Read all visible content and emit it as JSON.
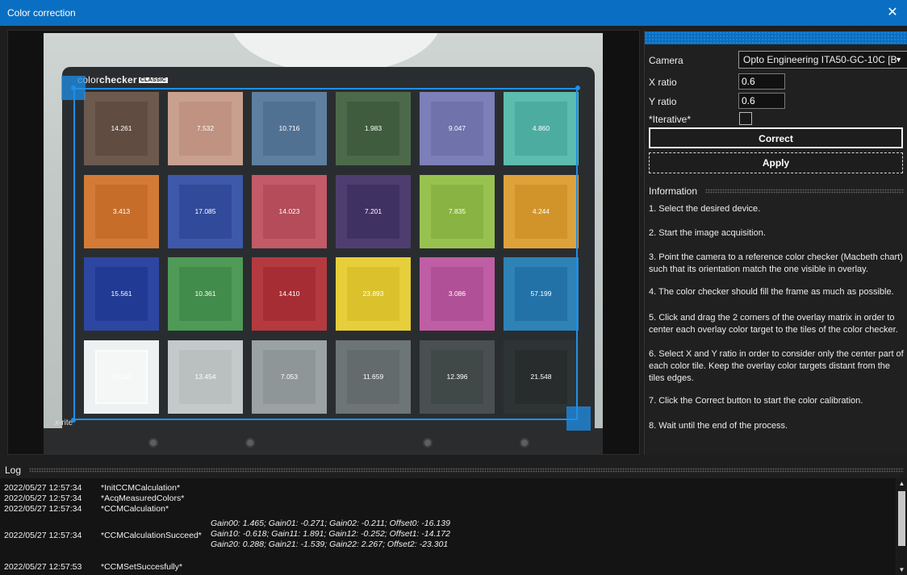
{
  "window": {
    "title": "Color correction",
    "close_symbol": "✕"
  },
  "chart_board": {
    "brand_light": "color",
    "brand_bold": "checker",
    "brand_tag": "CLASSIC",
    "footer_text": "x-rite",
    "tiles": [
      {
        "value": "14.261",
        "color": "#6d5a4e",
        "inner": "#5e4a40"
      },
      {
        "value": "7.532",
        "color": "#c9a08f",
        "inner": "#bd8f80"
      },
      {
        "value": "10.716",
        "color": "#5e7fa0",
        "inner": "#4f6e90"
      },
      {
        "value": "1.983",
        "color": "#4c6a4a",
        "inner": "#3d5a3c"
      },
      {
        "value": "9.047",
        "color": "#7d80b8",
        "inner": "#6c70a8"
      },
      {
        "value": "4.860",
        "color": "#5cbcae",
        "inner": "#4aa99d"
      },
      {
        "value": "3.413",
        "color": "#d37b36",
        "inner": "#c36b28"
      },
      {
        "value": "17.085",
        "color": "#3e59aa",
        "inner": "#2f4896"
      },
      {
        "value": "14.023",
        "color": "#c25a68",
        "inner": "#b14a58"
      },
      {
        "value": "7.201",
        "color": "#4e3e70",
        "inner": "#3e2f60"
      },
      {
        "value": "7.835",
        "color": "#98c250",
        "inner": "#86b040"
      },
      {
        "value": "4.244",
        "color": "#dea23a",
        "inner": "#cf9228"
      },
      {
        "value": "15.561",
        "color": "#2c46a2",
        "inner": "#203890"
      },
      {
        "value": "10.361",
        "color": "#4e9a56",
        "inner": "#3f8a48"
      },
      {
        "value": "14.410",
        "color": "#b53a40",
        "inner": "#a32c32"
      },
      {
        "value": "23.893",
        "color": "#e6cf3a",
        "inner": "#d8c02a"
      },
      {
        "value": "3.086",
        "color": "#bf5ea4",
        "inner": "#ad4e94"
      },
      {
        "value": "57.199",
        "color": "#2e82b6",
        "inner": "#2070a6"
      },
      {
        "value": "29.142",
        "color": "#eef1f1",
        "inner": "#f7f8f8"
      },
      {
        "value": "13.454",
        "color": "#c4c9ca",
        "inner": "#b8bdbe"
      },
      {
        "value": "7.053",
        "color": "#9aa2a3",
        "inner": "#8c9495"
      },
      {
        "value": "11.659",
        "color": "#6d7576",
        "inner": "#626a6b"
      },
      {
        "value": "12.396",
        "color": "#4a5051",
        "inner": "#404647"
      },
      {
        "value": "21.548",
        "color": "#2e3334",
        "inner": "#272b2c"
      }
    ]
  },
  "settings": {
    "camera_label": "Camera",
    "camera_value": "Opto Engineering ITA50-GC-10C [B",
    "x_ratio_label": "X ratio",
    "x_ratio_value": "0.6",
    "y_ratio_label": "Y ratio",
    "y_ratio_value": "0.6",
    "iterative_label": "*Iterative*",
    "iterative_checked": false,
    "correct_label": "Correct",
    "apply_label": "Apply"
  },
  "information": {
    "heading": "Information",
    "steps": [
      "1. Select the desired device.",
      "2. Start the image acquisition.",
      "3. Point the camera to a reference color checker (Macbeth chart) such that its orientation match the one visible in overlay.",
      "4. The color checker should fill the frame as much as possible.",
      "5. Click and drag the 2 corners of the overlay matrix in order to center each overlay color target to the tiles of the color checker.",
      "6. Select X and Y ratio in order to consider only the center part of each color tile. Keep the overlay color targets distant from the tiles edges.",
      "7. Click the Correct button to start the color calibration.",
      "8. Wait until the end of the process."
    ]
  },
  "log": {
    "heading": "Log",
    "entries": [
      {
        "time": "2022/05/27 12:57:34",
        "message": "*InitCCMCalculation*"
      },
      {
        "time": "2022/05/27 12:57:34",
        "message": "*AcqMeasuredColors*"
      },
      {
        "time": "2022/05/27 12:57:34",
        "message": "*CCMCalculation*"
      },
      {
        "time": "2022/05/27 12:57:34",
        "message": "*CCMCalculationSucceed*"
      },
      {
        "time": "2022/05/27 12:57:53",
        "message": "*CCMSetSuccesfully*"
      }
    ],
    "details": [
      "Gain00: 1.465;  Gain01: -0.271;  Gain02: -0.211; Offset0: -16.139",
      "Gain10: -0.618;  Gain11: 1.891;  Gain12: -0.252; Offset1: -14.172",
      "Gain20: 0.288;  Gain21: -1.539;  Gain22: 2.267; Offset2: -23.301"
    ]
  }
}
